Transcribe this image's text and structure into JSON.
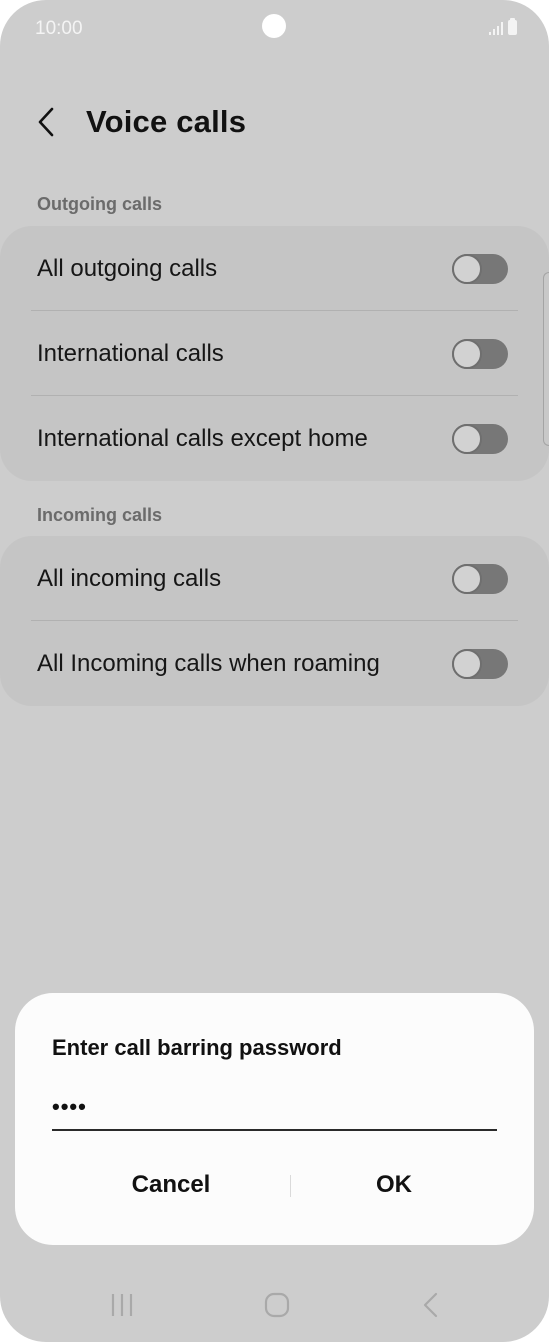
{
  "status_bar": {
    "time": "10:00",
    "icons": [
      "signal-icon",
      "battery-icon"
    ]
  },
  "header": {
    "title": "Voice calls",
    "back_icon": "chevron-left-icon"
  },
  "sections": [
    {
      "title": "Outgoing calls",
      "items": [
        {
          "label": "All outgoing calls",
          "enabled": false
        },
        {
          "label": "International calls",
          "enabled": false
        },
        {
          "label": "International calls except home",
          "enabled": false
        }
      ]
    },
    {
      "title": "Incoming calls",
      "items": [
        {
          "label": "All incoming calls",
          "enabled": false
        },
        {
          "label": "All Incoming calls when roaming",
          "enabled": false
        }
      ]
    }
  ],
  "dialog": {
    "title": "Enter call barring password",
    "password_value": "••••",
    "cancel_label": "Cancel",
    "ok_label": "OK"
  },
  "nav_bar": {
    "icons": [
      "recent-apps-icon",
      "home-icon",
      "back-icon"
    ]
  },
  "colors": {
    "background_dimmed": "#cdcdcd",
    "card": "#c5c5c5",
    "toggle_track_off": "#777777",
    "dialog": "#fcfcfc"
  }
}
